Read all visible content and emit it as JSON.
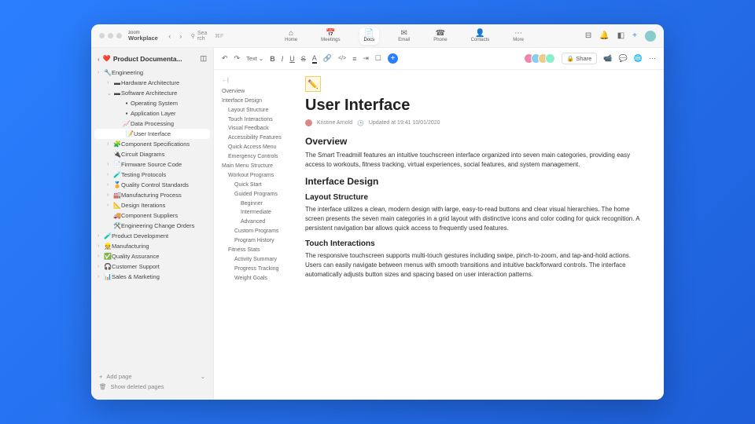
{
  "brand": {
    "line1": "zoom",
    "line2": "Workplace"
  },
  "nav": {
    "back": "‹",
    "forward": "›"
  },
  "search": {
    "placeholder": "Search",
    "shortcut": "⌘F"
  },
  "tabs": [
    {
      "icon": "⌂",
      "label": "Home"
    },
    {
      "icon": "📅",
      "label": "Meetings"
    },
    {
      "icon": "📄",
      "label": "Docs",
      "active": true
    },
    {
      "icon": "✉",
      "label": "Email"
    },
    {
      "icon": "☎",
      "label": "Phone"
    },
    {
      "icon": "👤",
      "label": "Contacts"
    },
    {
      "icon": "⋯",
      "label": "More"
    }
  ],
  "rightIcons": [
    "⊟",
    "🔔",
    "◧",
    "+",
    "●"
  ],
  "sideHead": {
    "title": "Product Documenta...",
    "icon": "❤️"
  },
  "tree": [
    {
      "d": 0,
      "c": "›",
      "e": "🔧",
      "t": "Engineering"
    },
    {
      "d": 1,
      "c": "›",
      "e": "▬",
      "t": "Hardware Architecture"
    },
    {
      "d": 1,
      "c": "⌄",
      "e": "▬",
      "t": "Software Architecture"
    },
    {
      "d": 2,
      "c": "",
      "e": "▪",
      "t": "Operating System"
    },
    {
      "d": 2,
      "c": "",
      "e": "▪",
      "t": "Application Layer"
    },
    {
      "d": 2,
      "c": "",
      "e": "📈",
      "t": "Data Processing"
    },
    {
      "d": 2,
      "c": "",
      "e": "📝",
      "t": "User Interface",
      "active": true
    },
    {
      "d": 1,
      "c": "›",
      "e": "🧩",
      "t": "Component Specifications"
    },
    {
      "d": 1,
      "c": "",
      "e": "🔌",
      "t": "Circuit Diagrams"
    },
    {
      "d": 1,
      "c": "›",
      "e": "📄",
      "t": "Firmware Source Code"
    },
    {
      "d": 1,
      "c": "›",
      "e": "🧪",
      "t": "Testing Protocols"
    },
    {
      "d": 1,
      "c": "›",
      "e": "🏅",
      "t": "Quality Control Standards"
    },
    {
      "d": 1,
      "c": "›",
      "e": "🏭",
      "t": "Manufacturing Process"
    },
    {
      "d": 1,
      "c": "›",
      "e": "📐",
      "t": "Design Iterations"
    },
    {
      "d": 1,
      "c": "",
      "e": "🚚",
      "t": "Component Suppliers"
    },
    {
      "d": 1,
      "c": "",
      "e": "🛠️",
      "t": "Engineering Change Orders"
    },
    {
      "d": 0,
      "c": "›",
      "e": "🧪",
      "t": "Product Development"
    },
    {
      "d": 0,
      "c": "›",
      "e": "👷",
      "t": "Manufacturing"
    },
    {
      "d": 0,
      "c": "›",
      "e": "✅",
      "t": "Quality Assurance"
    },
    {
      "d": 0,
      "c": "›",
      "e": "🎧",
      "t": "Customer Support"
    },
    {
      "d": 0,
      "c": "›",
      "e": "📊",
      "t": "Sales & Marketing"
    }
  ],
  "sideFoot": {
    "add": "Add page",
    "deleted": "Show deleted pages"
  },
  "toolbar": {
    "undo": "↶",
    "redo": "↷",
    "text": "Text ⌄",
    "b": "B",
    "i": "I",
    "u": "U",
    "s": "S",
    "a": "A",
    "link": "🔗",
    "code": "</>",
    "align": "≡",
    "indent": "⇥",
    "box": "☐",
    "plus": "+",
    "share": "🔒 Share",
    "video": "📹",
    "chat": "💬",
    "globe": "🌐",
    "more": "⋯"
  },
  "avatars": [
    "#e8a",
    "#8ce",
    "#ec8",
    "#8ec"
  ],
  "outline": {
    "back": "←|",
    "items": [
      {
        "t": "Overview",
        "l": 0
      },
      {
        "t": "Interface Design",
        "l": 0
      },
      {
        "t": "Layout Structure",
        "l": 1
      },
      {
        "t": "Touch Interactions",
        "l": 1
      },
      {
        "t": "Visual Feedback",
        "l": 1
      },
      {
        "t": "Accessibility Features",
        "l": 1
      },
      {
        "t": "Quick Access Menu",
        "l": 1
      },
      {
        "t": "Emergency Controls",
        "l": 1
      },
      {
        "t": "Main Menu Structure",
        "l": 0
      },
      {
        "t": "Workout Programs",
        "l": 1
      },
      {
        "t": "Quick Start",
        "l": 2
      },
      {
        "t": "Guided Programs",
        "l": 2
      },
      {
        "t": "Beginner",
        "l": 3
      },
      {
        "t": "Intermediate",
        "l": 3
      },
      {
        "t": "Advanced",
        "l": 3
      },
      {
        "t": "Custom Programs",
        "l": 2
      },
      {
        "t": "Program History",
        "l": 2
      },
      {
        "t": "Fitness Stats",
        "l": 1
      },
      {
        "t": "Activity Summary",
        "l": 2
      },
      {
        "t": "Progress Tracking",
        "l": 2
      },
      {
        "t": "Weight Goals",
        "l": 2
      }
    ]
  },
  "doc": {
    "icon": "✏️",
    "title": "User Interface",
    "author": "Kristine Arnold",
    "updated": "Updated at 19:41 10/01/2020",
    "h2a": "Overview",
    "p1": "The Smart Treadmill features an intuitive touchscreen interface organized into seven main categories, providing easy access to workouts, fitness tracking, virtual experiences, social features, and system management.",
    "h2b": "Interface Design",
    "h3a": "Layout Structure",
    "p2": "The interface utilizes a clean, modern design with large, easy-to-read buttons and clear visual hierarchies. The home screen presents the seven main categories in a grid layout with distinctive icons and color coding for quick recognition. A persistent navigation bar allows quick access to frequently used features.",
    "h3b": "Touch Interactions",
    "p3": "The responsive touchscreen supports multi-touch gestures including swipe, pinch-to-zoom, and tap-and-hold actions. Users can easily navigate between menus with smooth transitions and intuitive back/forward controls. The interface automatically adjusts button sizes and spacing based on user interaction patterns."
  }
}
